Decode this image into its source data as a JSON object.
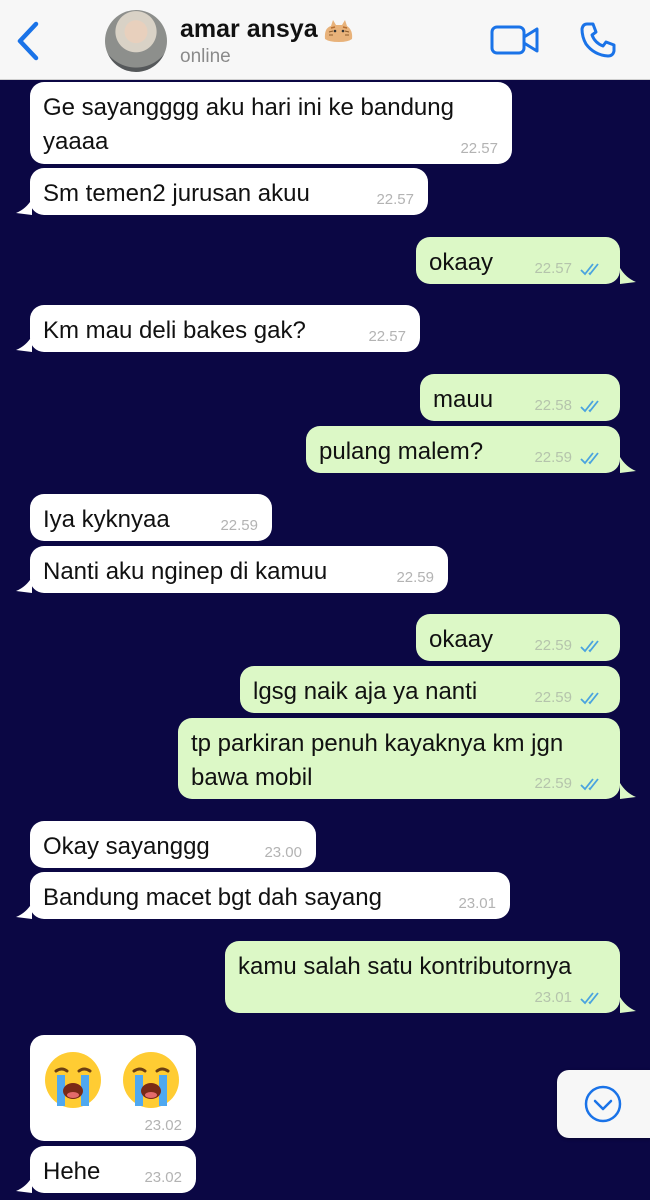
{
  "header": {
    "contact_name": "amar ansya",
    "status": "online"
  },
  "colors": {
    "background": "#0b0744",
    "incoming": "#ffffff",
    "outgoing": "#dcf8c6",
    "accent": "#1a73e8"
  },
  "icons": {
    "back": "chevron-left-icon",
    "name_suffix": "cat-emoji-icon",
    "video": "video-camera-icon",
    "call": "phone-icon",
    "read": "double-check-icon",
    "scroll": "chevron-down-circle-icon"
  },
  "messages": [
    {
      "dir": "in",
      "text": "Ge sayangggg aku hari ini ke bandung yaaaa",
      "time": "22.57"
    },
    {
      "dir": "in",
      "text": "Sm temen2 jurusan akuu",
      "time": "22.57"
    },
    {
      "dir": "out",
      "text": "okaay",
      "time": "22.57",
      "read": true
    },
    {
      "dir": "in",
      "text": "Km mau deli bakes gak?",
      "time": "22.57"
    },
    {
      "dir": "out",
      "text": "mauu",
      "time": "22.58",
      "read": true
    },
    {
      "dir": "out",
      "text": "pulang malem?",
      "time": "22.59",
      "read": true
    },
    {
      "dir": "in",
      "text": "Iya kyknyaa",
      "time": "22.59"
    },
    {
      "dir": "in",
      "text": "Nanti aku nginep di kamuu",
      "time": "22.59"
    },
    {
      "dir": "out",
      "text": "okaay",
      "time": "22.59",
      "read": true
    },
    {
      "dir": "out",
      "text": "lgsg naik aja ya nanti",
      "time": "22.59",
      "read": true
    },
    {
      "dir": "out",
      "text": "tp parkiran penuh kayaknya km jgn bawa mobil",
      "time": "22.59",
      "read": true
    },
    {
      "dir": "in",
      "text": "Okay sayanggg",
      "time": "23.00"
    },
    {
      "dir": "in",
      "text": "Bandung macet bgt dah sayang",
      "time": "23.01"
    },
    {
      "dir": "out",
      "text": "kamu salah satu kontributornya",
      "time": "23.01",
      "read": true
    },
    {
      "dir": "in",
      "emoji": [
        "loudly-crying-face-emoji",
        "loudly-crying-face-emoji"
      ],
      "time": "23.02"
    },
    {
      "dir": "in",
      "text": "Hehe",
      "time": "23.02"
    }
  ]
}
